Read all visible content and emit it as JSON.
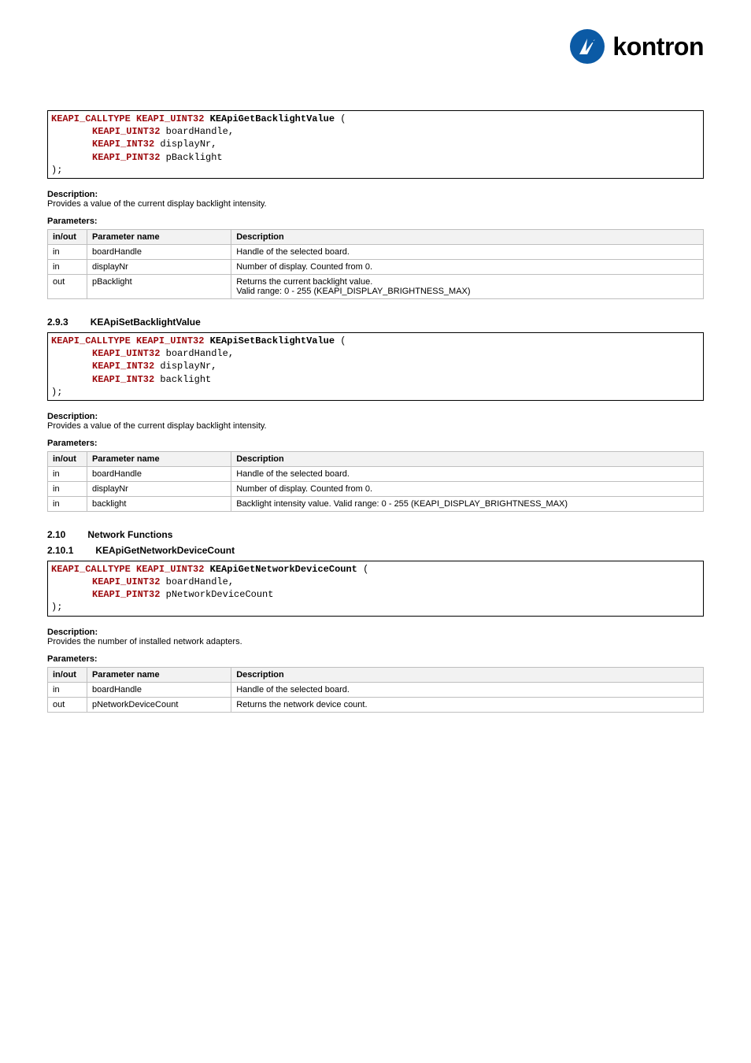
{
  "logo": {
    "text": "kontron"
  },
  "sec1": {
    "code": {
      "prefix1": "KEAPI_CALLTYPE",
      "prefix2": "KEAPI_UINT32",
      "fn": "KEApiGetBacklightValue",
      "p1t": "KEAPI_UINT32",
      "p1n": "boardHandle,",
      "p2t": "KEAPI_INT32",
      "p2n": "displayNr,",
      "p3t": "KEAPI_PINT32",
      "p3n": "pBacklight"
    },
    "descLabel": "Description:",
    "descText": "Provides a value of the current display backlight intensity.",
    "paramsLabel": "Parameters:",
    "th": [
      "in/out",
      "Parameter name",
      "Description"
    ],
    "rows": [
      [
        "in",
        "boardHandle",
        "Handle of the selected board."
      ],
      [
        "in",
        "displayNr",
        "Number of display. Counted from 0."
      ],
      [
        "out",
        "pBacklight",
        "Returns the current backlight value.\nValid range: 0 - 255 (KEAPI_DISPLAY_BRIGHTNESS_MAX)"
      ]
    ]
  },
  "sec2": {
    "num": "2.9.3",
    "title": "KEApiSetBacklightValue",
    "code": {
      "prefix1": "KEAPI_CALLTYPE",
      "prefix2": "KEAPI_UINT32",
      "fn": "KEApiSetBacklightValue",
      "p1t": "KEAPI_UINT32",
      "p1n": "boardHandle,",
      "p2t": "KEAPI_INT32",
      "p2n": "displayNr,",
      "p3t": "KEAPI_INT32",
      "p3n": "backlight"
    },
    "descLabel": "Description:",
    "descText": "Provides a value of the current display backlight intensity.",
    "paramsLabel": "Parameters:",
    "th": [
      "in/out",
      "Parameter name",
      "Description"
    ],
    "rows": [
      [
        "in",
        "boardHandle",
        "Handle of the selected board."
      ],
      [
        "in",
        "displayNr",
        "Number of display. Counted from 0."
      ],
      [
        "in",
        "backlight",
        "Backlight intensity value. Valid range: 0 - 255 (KEAPI_DISPLAY_BRIGHTNESS_MAX)"
      ]
    ]
  },
  "sec3a": {
    "num": "2.10",
    "title": "Network Functions"
  },
  "sec3": {
    "num": "2.10.1",
    "title": "KEApiGetNetworkDeviceCount",
    "code": {
      "prefix1": "KEAPI_CALLTYPE",
      "prefix2": "KEAPI_UINT32",
      "fn": "KEApiGetNetworkDeviceCount",
      "p1t": "KEAPI_UINT32",
      "p1n": "boardHandle,",
      "p2t": "KEAPI_PINT32",
      "p2n": "pNetworkDeviceCount"
    },
    "descLabel": "Description:",
    "descText": "Provides the number of installed network adapters.",
    "paramsLabel": "Parameters:",
    "th": [
      "in/out",
      "Parameter name",
      "Description"
    ],
    "rows": [
      [
        "in",
        "boardHandle",
        "Handle of the selected board."
      ],
      [
        "out",
        "pNetworkDeviceCount",
        "Returns the network device count."
      ]
    ]
  }
}
